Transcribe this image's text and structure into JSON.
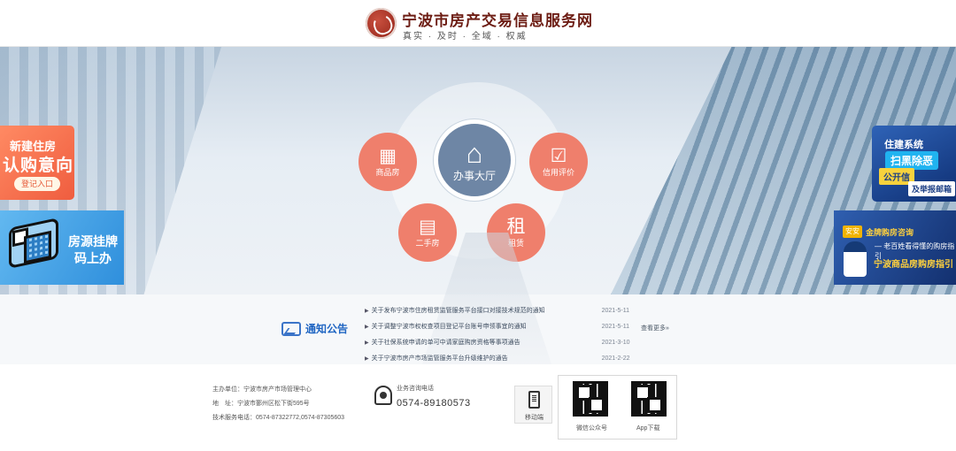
{
  "header": {
    "title": "宁波市房产交易信息服务网",
    "subtitle": "真实 · 及时 · 全域 · 权威"
  },
  "services": [
    {
      "label": "商品房",
      "icon": "building-icon"
    },
    {
      "label": "办事大厅",
      "icon": "house-tie-icon"
    },
    {
      "label": "信用评价",
      "icon": "checklist-icon"
    },
    {
      "label": "二手房",
      "icon": "hand-building-icon"
    },
    {
      "label": "租赁",
      "icon": "rent-clipboard-icon"
    }
  ],
  "promos": {
    "left_top": {
      "line1": "新建住房",
      "line2": "认购意向",
      "button": "登记入口"
    },
    "left_bottom": {
      "line1": "房源挂牌",
      "line2": "码上办"
    },
    "right_top": {
      "line1": "住建系统",
      "line2": "扫黑除恶",
      "line3": "公开信",
      "line4": "及举报邮箱"
    },
    "right_bottom": {
      "badge": "安安",
      "line1": "金牌购房咨询",
      "line2": "— 老百姓看得懂的购房指引",
      "line3": "宁波商品房购房指引"
    }
  },
  "notices": {
    "title": "通知公告",
    "more": "查看更多»",
    "items": [
      {
        "text": "关于发布宁波市住房租赁监管服务平台接口对接技术规范的通知",
        "date": "2021-5-11"
      },
      {
        "text": "关于调整宁波市权权查项目登记平台账号申领事宜的通知",
        "date": "2021-5-11"
      },
      {
        "text": "关于社保系统申请的单可中请家庭购房资格等事项通告",
        "date": "2021-3-10"
      },
      {
        "text": "关于宁波市房产市场监管服务平台升级维护的通告",
        "date": "2021-2-22"
      }
    ]
  },
  "footer": {
    "host": "主办单位：宁波市房产市场管理中心",
    "address": "地　址：宁波市鄞州区松下街595号",
    "support": "技术服务电话：0574-87322772,0574-87305603",
    "hotline_label": "业务咨询电话",
    "hotline_number": "0574-89180573",
    "mobile_label": "移动端",
    "qr_labels": [
      "微信公众号",
      "App下载"
    ]
  },
  "colors": {
    "service": "#ef7f6c",
    "main_service": "#6e86a5",
    "notice_title": "#1f65c2",
    "brand": "#6d1d14"
  }
}
